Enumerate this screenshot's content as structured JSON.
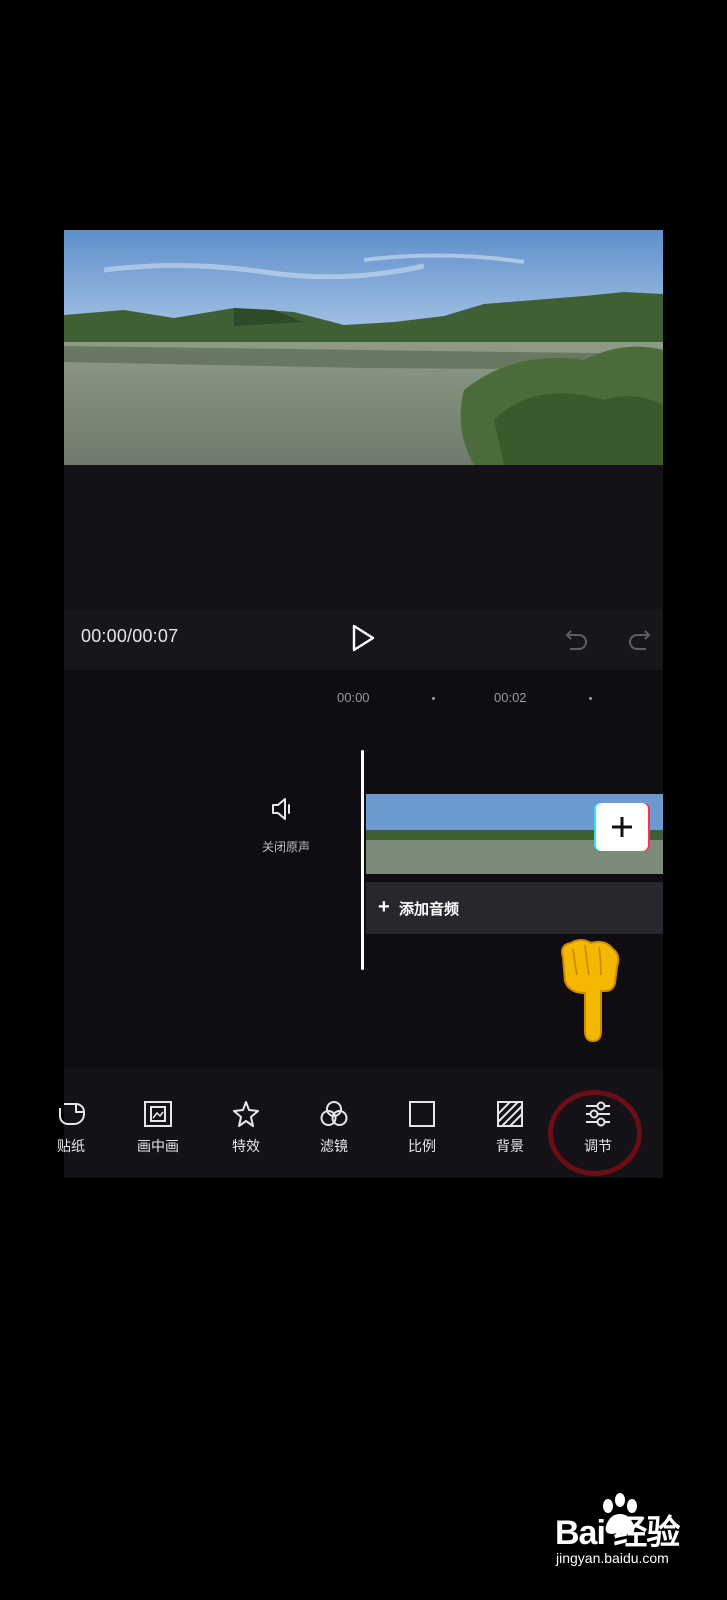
{
  "player": {
    "time": "00:00/00:07"
  },
  "ruler": {
    "marks": [
      "00:00",
      "00:02"
    ]
  },
  "track": {
    "mute_label": "关闭原声",
    "add_audio_label": "添加音频",
    "add_audio_plus": "+"
  },
  "toolbar": {
    "items": [
      {
        "label": "贴纸",
        "icon": "sticker-icon"
      },
      {
        "label": "画中画",
        "icon": "picture-in-picture-icon"
      },
      {
        "label": "特效",
        "icon": "effects-star-icon"
      },
      {
        "label": "滤镜",
        "icon": "filter-circles-icon"
      },
      {
        "label": "比例",
        "icon": "ratio-square-icon"
      },
      {
        "label": "背景",
        "icon": "background-hatch-icon"
      },
      {
        "label": "调节",
        "icon": "adjust-sliders-icon"
      }
    ]
  },
  "watermark": {
    "logo": "Bai  经验",
    "url": "jingyan.baidu.com"
  },
  "colors": {
    "app_background": "#141217",
    "highlight_ring": "#7a0d14",
    "pointer_hand": "#f5b800"
  }
}
